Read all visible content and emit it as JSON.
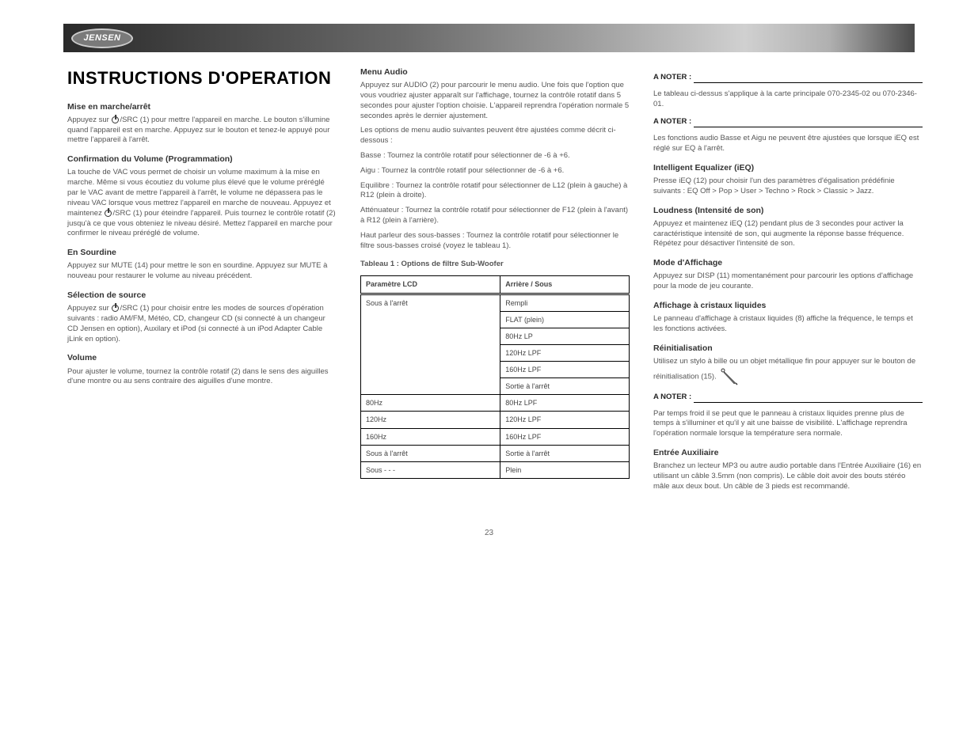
{
  "header": {
    "brand": "JENSEN"
  },
  "title": "INSTRUCTIONS D'OPERATION",
  "left": {
    "s1_title": "Mise en marche/arrêt",
    "s1_body": "Appuyez sur  /SRC (1) pour mettre l'appareil en marche. Le bouton s'illumine quand l'appareil est en marche. Appuyez sur le bouton et tenez-le appuyé pour mettre l'appareil à l'arrêt.",
    "s2_title": "Confirmation du Volume (Programmation)",
    "s2_body": "La touche de VAC vous permet de choisir un volume maximum à la mise en marche. Même si vous écoutiez du volume plus élevé que le volume préréglé par le VAC avant de mettre l'appareil à l'arrêt, le volume ne dépassera pas le niveau VAC lorsque vous mettrez l'appareil en marche de nouveau. Appuyez et maintenez  /SRC (1) pour éteindre l'appareil. Puis tournez le contrôle rotatif (2) jusqu'à ce que vous obteniez le niveau désiré. Mettez l'appareil en marche pour confirmer le niveau préréglé de volume.",
    "s3_title": "En Sourdine",
    "s3_body": "Appuyez sur MUTE (14) pour mettre le son en sourdine. Appuyez sur MUTE à nouveau pour restaurer le volume au niveau précédent.",
    "s4_title": "Sélection de source",
    "s4_body": "Appuyez sur  /SRC (1) pour choisir entre les modes de sources d'opération suivants : radio AM/FM, Météo, CD, changeur CD (si connecté à un changeur CD Jensen en option), Auxilary et iPod (si connecté à un iPod Adapter Cable jLink en option).",
    "s5_title": "Volume",
    "s5_body": "Pour ajuster le volume, tournez la contrôle rotatif (2) dans le sens des aiguilles d'une montre ou au sens contraire des aiguilles d'une montre."
  },
  "mid": {
    "s1_title": "Menu Audio",
    "s1_body1": "Appuyez sur AUDIO (2) pour parcourir le menu audio. Une fois que l'option que vous voudriez ajuster apparaît sur l'affichage, tournez la contrôle rotatif dans 5 secondes pour ajuster l'option choisie. L'appareil reprendra l'opération normale 5 secondes après le dernier ajustement.",
    "s1_body2": "Les options de menu audio suivantes peuvent être ajustées comme décrit ci-dessous :",
    "bass": "Basse : Tournez la contrôle rotatif pour sélectionner de -6 à +6.",
    "treble": "Aigu : Tournez la contrôle rotatif pour sélectionner de -6 à +6.",
    "balance": "Equilibre : Tournez la contrôle rotatif pour sélectionner de L12 (plein à gauche) à R12 (plein à droite).",
    "fader": "Atténuateur : Tournez la contrôle rotatif pour sélectionner de F12 (plein à l'avant) à R12 (plein à l'arrière).",
    "subwoofer": "Haut parleur des sous-basses : Tournez la contrôle rotatif pour sélectionner le filtre sous-basses croisé (voyez le tableau 1).",
    "caption": "Tableau 1 : Options de filtre Sub-Woofer",
    "table": {
      "header1": "Paramètre LCD",
      "header2": "Arrière / Sous",
      "rows": [
        {
          "lcd": "Sous à l'arrêt",
          "rear": "Rempli",
          "rowspan": 6,
          "sub_merged": true
        },
        {
          "rear": "FLAT (plein)"
        },
        {
          "rear": "80Hz LP"
        },
        {
          "rear": "120Hz LPF"
        },
        {
          "rear": "160Hz LPF"
        },
        {
          "rear": "Sortie à l'arrêt"
        },
        {
          "lcd": "80Hz",
          "rear": "80Hz LPF"
        },
        {
          "lcd": "120Hz",
          "rear": "120Hz LPF"
        },
        {
          "lcd": "160Hz",
          "rear": "160Hz LPF"
        },
        {
          "lcd": "Sous à l'arrêt",
          "rear": "Sortie à l'arrêt"
        },
        {
          "lcd": "Sous - - -",
          "rear": "Plein"
        }
      ]
    }
  },
  "right": {
    "note1": "A NOTER : Le tableau ci-dessus s'applique à la carte principale 070-2345-02 ou 070-2346-01.",
    "note2": "A NOTER : Les fonctions audio Basse et Aigu ne peuvent être ajustées que lorsque iEQ est réglé sur EQ à l'arrêt.",
    "s1_title": "Intelligent Equalizer (iEQ)",
    "s1_body": "Presse iEQ (12) pour choisir l'un des paramètres d'égalisation prédéfinie suivants : EQ Off > Pop > User > Techno > Rock > Classic > Jazz.",
    "s2_title": "Loudness (Intensité de son)",
    "s2_body": "Appuyez et maintenez iEQ (12) pendant plus de 3 secondes pour activer la caractéristique intensité de son, qui augmente la réponse basse fréquence. Répétez pour désactiver l'intensité de son.",
    "s3_title": "Mode d'Affichage",
    "s3_body": "Appuyez sur DISP (11) momentanément pour parcourir les options d'affichage pour la mode de jeu courante.",
    "s4_title": "Affichage à cristaux liquides",
    "s4_body": "Le panneau d'affichage à cristaux liquides (8) affiche la fréquence, le temps et les fonctions activées.",
    "s5_title": "Réinitialisation",
    "s5_body": "Utilisez un stylo à bille ou un objet métallique fin pour appuyer sur le bouton de réinitialisation (15).",
    "note3": "A NOTER : Par temps froid il se peut que le panneau à cristaux liquides prenne plus de temps à s'illuminer et qu'il y ait une baisse de visibilité. L'affichage reprendra l'opération normale lorsque la température sera normale.",
    "s6_title": "Entrée Auxiliaire",
    "s6_body": "Branchez un lecteur MP3 ou autre audio portable dans l'Entrée Auxiliaire (16) en utilisant un câble 3.5mm (non compris). Le câble doit avoir des bouts stéréo mâle aux deux bout. Un câble de 3 pieds est recommandé."
  },
  "page": "23"
}
